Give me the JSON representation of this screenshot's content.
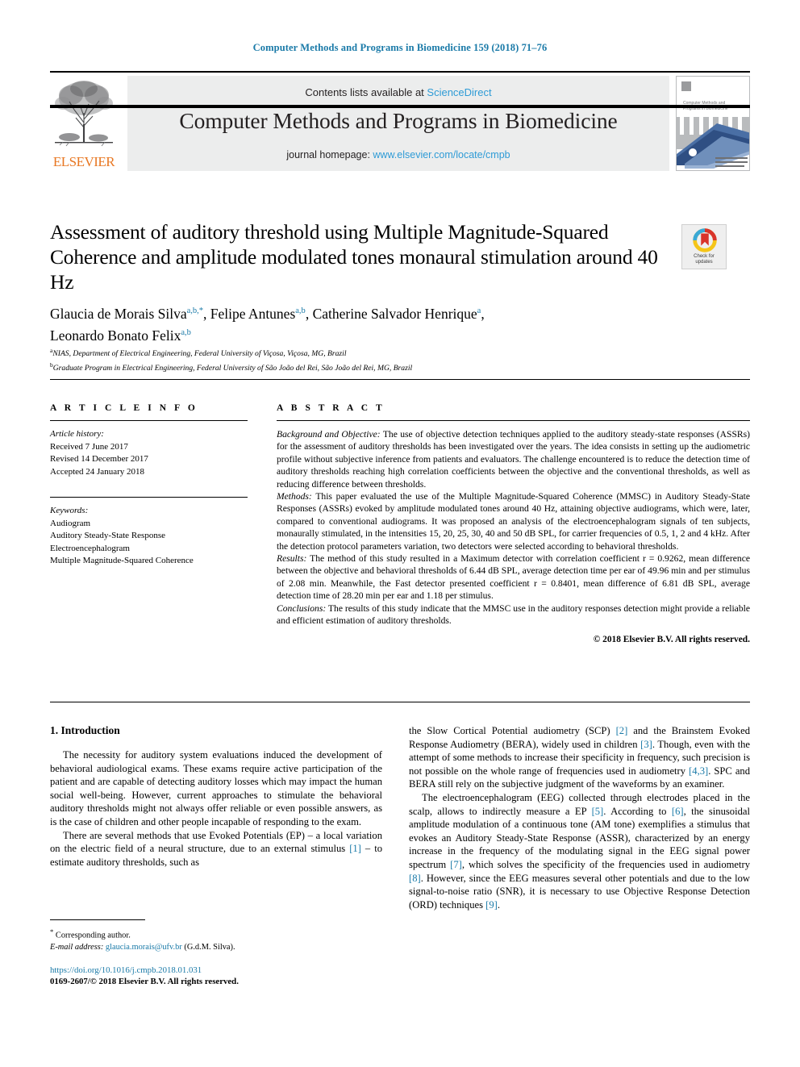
{
  "running_head": "Computer Methods and Programs in Biomedicine 159 (2018) 71–76",
  "masthead": {
    "publisher": "ELSEVIER",
    "contents_prefix": "Contents lists available at ",
    "contents_link": "ScienceDirect",
    "journal_title": "Computer Methods and Programs in Biomedicine",
    "homepage_prefix": "journal homepage: ",
    "homepage_link": "www.elsevier.com/locate/cmpb",
    "cover_title_line1": "Computer Methods and",
    "cover_title_line2": "Programs in Biomedicine"
  },
  "article": {
    "title": "Assessment of auditory threshold using Multiple Magnitude-Squared Coherence and amplitude modulated tones monaural stimulation around 40 Hz",
    "crossmark_line1": "Check for",
    "crossmark_line2": "updates"
  },
  "authors": {
    "line1_a": "Glaucia de Morais Silva",
    "line1_a_sup": "a,b,",
    "line1_a_star": "*",
    "line1_b": "Felipe Antunes",
    "line1_b_sup": "a,b",
    "line1_c": "Catherine Salvador Henrique",
    "line1_c_sup": "a",
    "line2_d": "Leonardo Bonato Felix",
    "line2_d_sup": "a,b"
  },
  "affiliations": [
    {
      "marker": "a",
      "text": "NIAS, Department of Electrical Engineering, Federal University of Viçosa, Viçosa, MG, Brazil"
    },
    {
      "marker": "b",
      "text": "Graduate Program in Electrical Engineering, Federal University of São João del Rei, São João del Rei, MG, Brazil"
    }
  ],
  "article_info": {
    "heading": "A R T I C L E  I N F O",
    "history_title": "Article history:",
    "history": [
      "Received 7 June 2017",
      "Revised 14 December 2017",
      "Accepted 24 January 2018"
    ],
    "keywords_title": "Keywords:",
    "keywords": [
      "Audiogram",
      "Auditory Steady-State Response",
      "Electroencephalogram",
      "Multiple Magnitude-Squared Coherence"
    ]
  },
  "abstract": {
    "heading": "A B S T R A C T",
    "background_label": "Background and Objective:",
    "background_text": " The use of objective detection techniques applied to the auditory steady-state responses (ASSRs) for the assessment of auditory thresholds has been investigated over the years. The idea consists in setting up the audiometric profile without subjective inference from patients and evaluators. The challenge encountered is to reduce the detection time of auditory thresholds reaching high correlation coefficients between the objective and the conventional thresholds, as well as reducing difference between thresholds.",
    "methods_label": "Methods:",
    "methods_text": " This paper evaluated the use of the Multiple Magnitude-Squared Coherence (MMSC) in Auditory Steady-State Responses (ASSRs) evoked by amplitude modulated tones around 40 Hz, attaining objective audiograms, which were, later, compared to conventional audiograms. It was proposed an analysis of the electroencephalogram signals of ten subjects, monaurally stimulated, in the intensities 15, 20, 25, 30, 40 and 50 dB SPL, for carrier frequencies of 0.5, 1, 2 and 4 kHz. After the detection protocol parameters variation, two detectors were selected according to behavioral thresholds.",
    "results_label": "Results:",
    "results_text": " The method of this study resulted in a Maximum detector with correlation coefficient r = 0.9262, mean difference between the objective and behavioral thresholds of 6.44 dB SPL, average detection time per ear of 49.96 min and per stimulus of 2.08 min. Meanwhile, the Fast detector presented coefficient r = 0.8401, mean difference of 6.81 dB SPL, average detection time of 28.20 min per ear and 1.18 per stimulus.",
    "conclusions_label": "Conclusions:",
    "conclusions_text": " The results of this study indicate that the MMSC use in the auditory responses detection might provide a reliable and efficient estimation of auditory thresholds.",
    "copyright": "© 2018 Elsevier B.V. All rights reserved."
  },
  "introduction": {
    "heading": "1. Introduction",
    "left_p1": "The necessity for auditory system evaluations induced the development of behavioral audiological exams. These exams require active participation of the patient and are capable of detecting auditory losses which may impact the human social well-being. However, current approaches to stimulate the behavioral auditory thresholds might not always offer reliable or even possible answers, as is the case of children and other people incapable of responding to the exam.",
    "left_p2_a": "There are several methods that use Evoked Potentials (EP) – a local variation on the electric field of a neural structure, due to an external stimulus ",
    "left_p2_cite1": "[1]",
    "left_p2_b": " – to estimate auditory thresholds, such as ",
    "right_p1_a": "the Slow Cortical Potential audiometry (SCP) ",
    "right_p1_cite1": "[2]",
    "right_p1_b": " and the Brainstem Evoked Response Audiometry (BERA), widely used in children ",
    "right_p1_cite2": "[3]",
    "right_p1_c": ". Though, even with the attempt of some methods to increase their specificity in frequency, such precision is not possible on the whole range of frequencies used in audiometry ",
    "right_p1_cite3": "[4,3]",
    "right_p1_d": ". SPC and BERA still rely on the subjective judgment of the waveforms by an examiner.",
    "right_p2_a": "The electroencephalogram (EEG) collected through electrodes placed in the scalp, allows to indirectly measure a EP ",
    "right_p2_cite1": "[5]",
    "right_p2_b": ". According to ",
    "right_p2_cite2": "[6]",
    "right_p2_c": ", the sinusoidal amplitude modulation of a continuous tone (AM tone) exemplifies a stimulus that evokes an Auditory Steady-State Response (ASSR), characterized by an energy increase in the frequency of the modulating signal in the EEG signal power spectrum ",
    "right_p2_cite3": "[7]",
    "right_p2_d": ", which solves the specificity of the frequencies used in audiometry ",
    "right_p2_cite4": "[8]",
    "right_p2_e": ". However, since the EEG measures several other potentials and due to the low signal-to-noise ratio (SNR), it is necessary to use Objective Response Detection (ORD) techniques ",
    "right_p2_cite5": "[9]",
    "right_p2_f": "."
  },
  "footnote": {
    "star": "*",
    "corresponding": " Corresponding author.",
    "email_label": "E-mail address:",
    "email": "glaucia.morais@ufv.br",
    "email_owner": " (G.d.M. Silva)."
  },
  "footer": {
    "doi": "https://doi.org/10.1016/j.cmpb.2018.01.031",
    "issn": "0169-2607/© 2018 Elsevier B.V. All rights reserved."
  },
  "colors": {
    "link": "#1a7aa8",
    "sciencedirect": "#2e9bd6",
    "elsevier_orange": "#e87722",
    "band": "#eceded"
  }
}
